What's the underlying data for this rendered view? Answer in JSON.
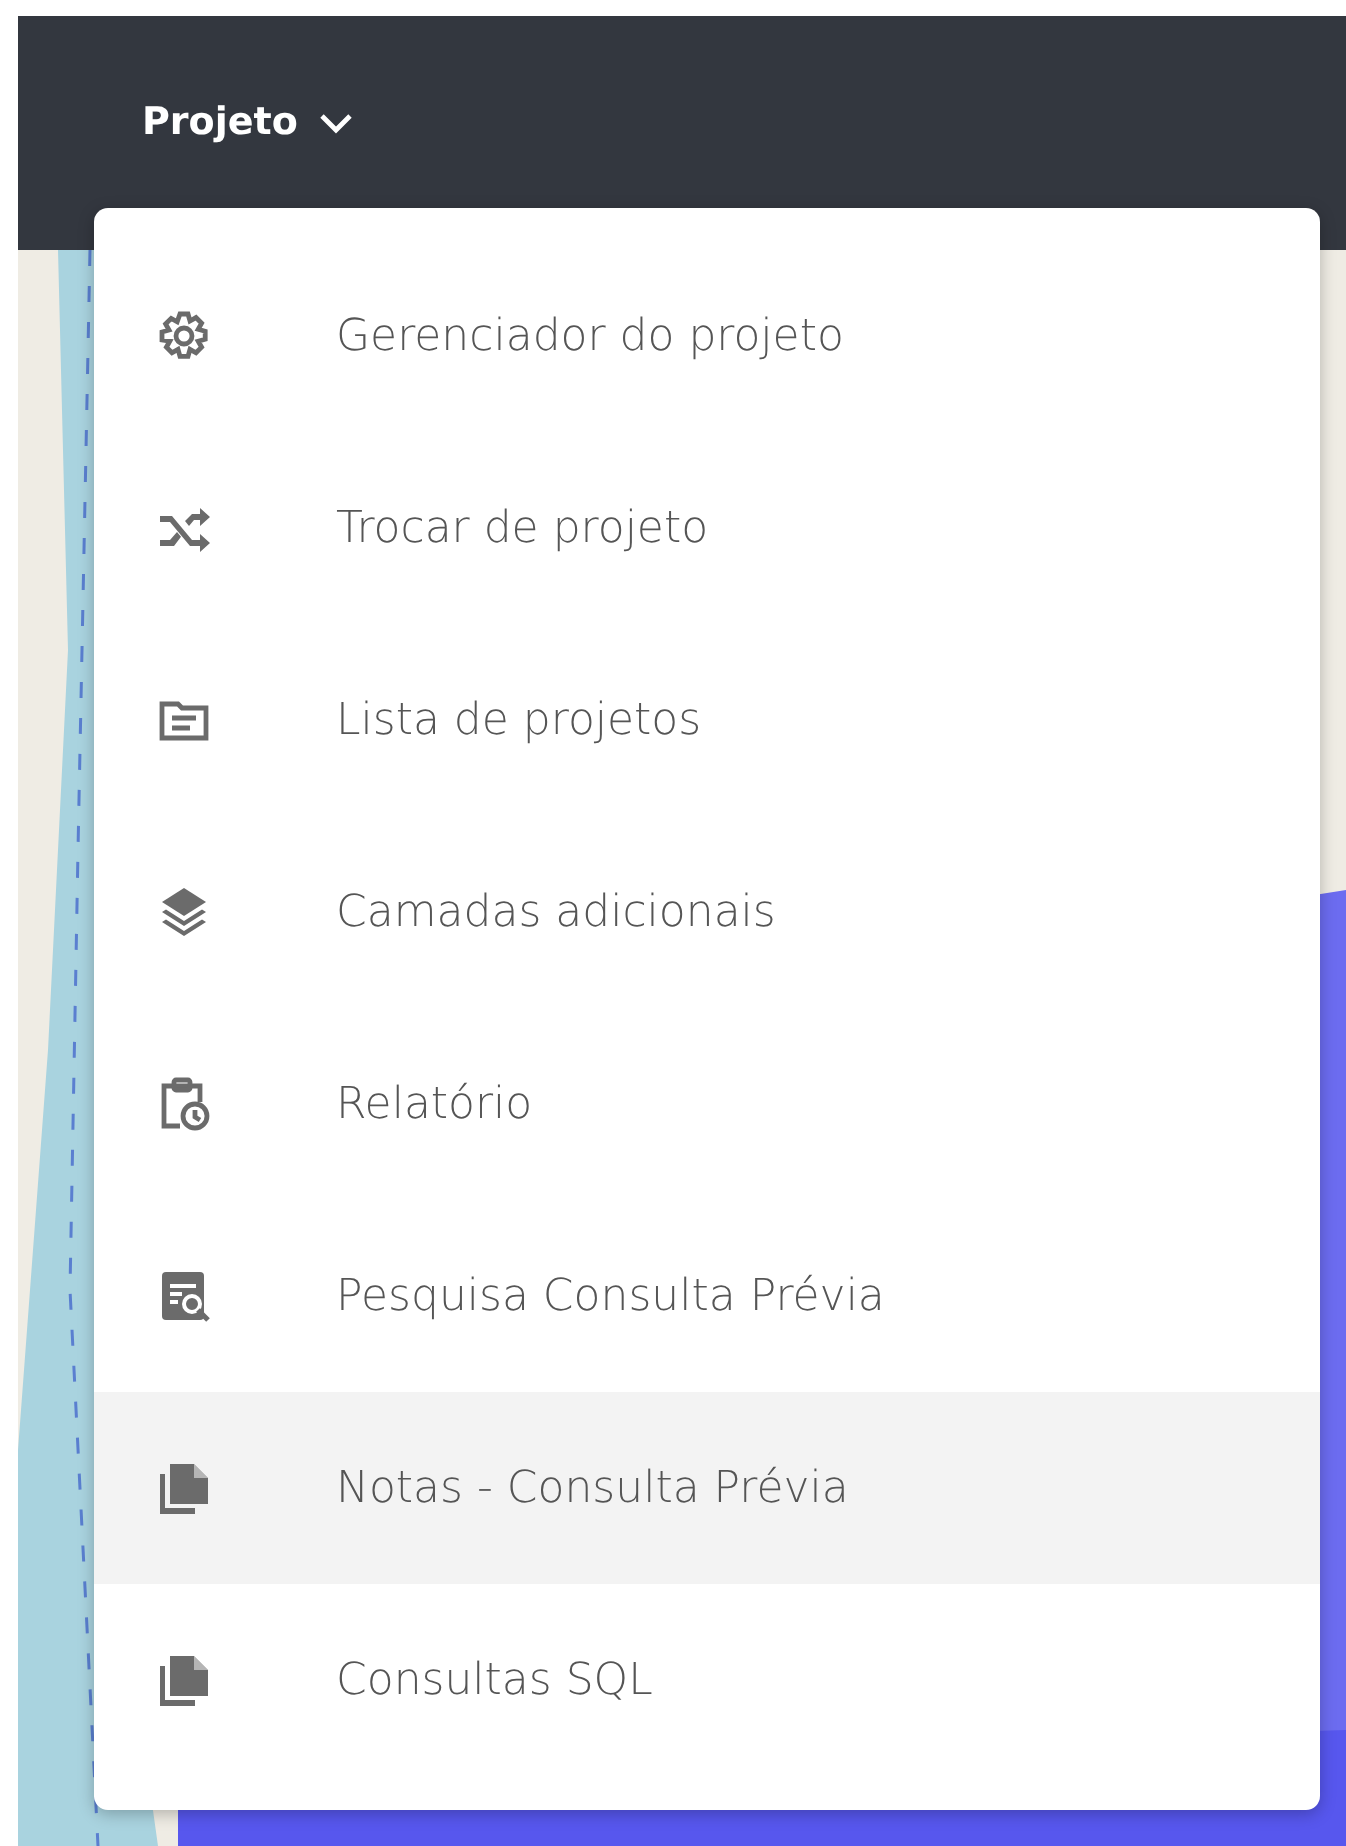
{
  "header": {
    "menu_title": "Projeto",
    "expanded": true
  },
  "menu": {
    "items": [
      {
        "label": "Gerenciador do projeto",
        "selected": false
      },
      {
        "label": "Trocar de projeto",
        "selected": false
      },
      {
        "label": "Lista de projetos",
        "selected": false
      },
      {
        "label": "Camadas adicionais",
        "selected": false
      },
      {
        "label": "Relatório",
        "selected": false
      },
      {
        "label": "Pesquisa Consulta Prévia",
        "selected": false
      },
      {
        "label": "Notas - Consulta Prévia",
        "selected": true
      },
      {
        "label": "Consultas SQL",
        "selected": false
      }
    ]
  }
}
